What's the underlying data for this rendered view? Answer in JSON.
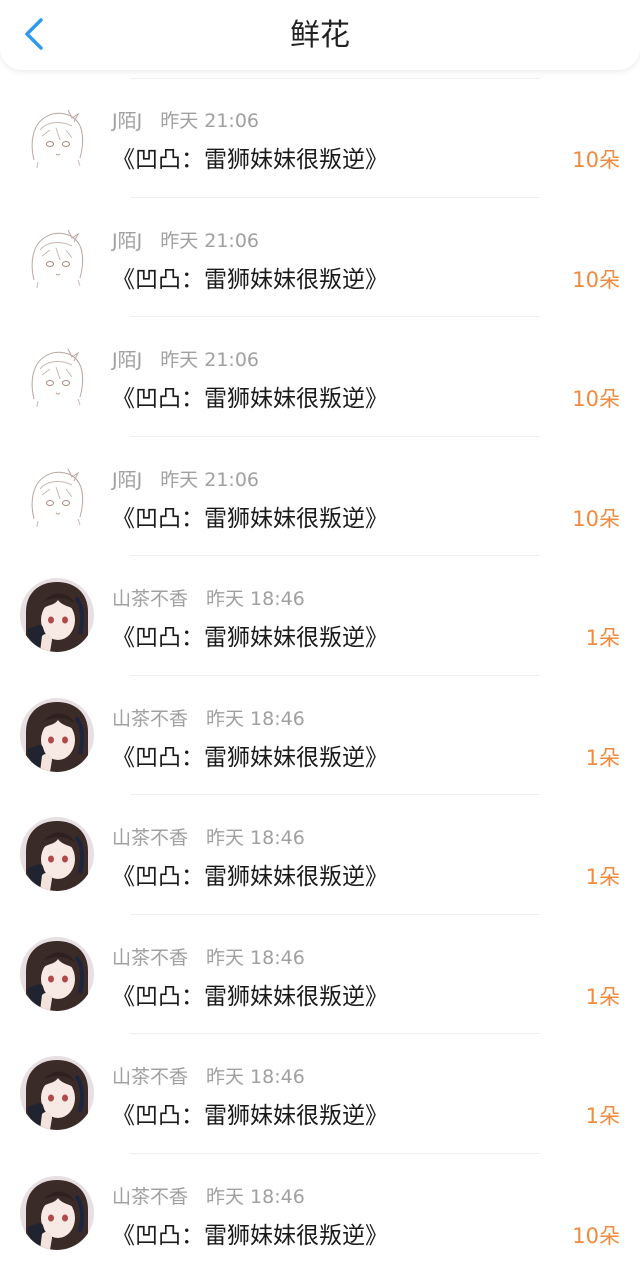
{
  "header": {
    "title": "鲜花",
    "back_icon": "chevron-left-icon",
    "accent_color": "#2f9bf0"
  },
  "colors": {
    "amount": "#ef8a3e",
    "meta": "#a0a0a0",
    "text": "#1a1a1a"
  },
  "gifts": [
    {
      "user": "J陌J",
      "time": "昨天 21:06",
      "book": "《凹凸：雷狮妹妹很叛逆》",
      "amount": "10朵",
      "avatar": "sketch-girl-avatar"
    },
    {
      "user": "J陌J",
      "time": "昨天 21:06",
      "book": "《凹凸：雷狮妹妹很叛逆》",
      "amount": "10朵",
      "avatar": "sketch-girl-avatar"
    },
    {
      "user": "J陌J",
      "time": "昨天 21:06",
      "book": "《凹凸：雷狮妹妹很叛逆》",
      "amount": "10朵",
      "avatar": "sketch-girl-avatar"
    },
    {
      "user": "J陌J",
      "time": "昨天 21:06",
      "book": "《凹凸：雷狮妹妹很叛逆》",
      "amount": "10朵",
      "avatar": "sketch-girl-avatar"
    },
    {
      "user": "山茶不香",
      "time": "昨天 18:46",
      "book": "《凹凸：雷狮妹妹很叛逆》",
      "amount": "1朵",
      "avatar": "anime-girl-avatar"
    },
    {
      "user": "山茶不香",
      "time": "昨天 18:46",
      "book": "《凹凸：雷狮妹妹很叛逆》",
      "amount": "1朵",
      "avatar": "anime-girl-avatar"
    },
    {
      "user": "山茶不香",
      "time": "昨天 18:46",
      "book": "《凹凸：雷狮妹妹很叛逆》",
      "amount": "1朵",
      "avatar": "anime-girl-avatar"
    },
    {
      "user": "山茶不香",
      "time": "昨天 18:46",
      "book": "《凹凸：雷狮妹妹很叛逆》",
      "amount": "1朵",
      "avatar": "anime-girl-avatar"
    },
    {
      "user": "山茶不香",
      "time": "昨天 18:46",
      "book": "《凹凸：雷狮妹妹很叛逆》",
      "amount": "1朵",
      "avatar": "anime-girl-avatar"
    },
    {
      "user": "山茶不香",
      "time": "昨天 18:46",
      "book": "《凹凸：雷狮妹妹很叛逆》",
      "amount": "10朵",
      "avatar": "anime-girl-avatar"
    }
  ]
}
